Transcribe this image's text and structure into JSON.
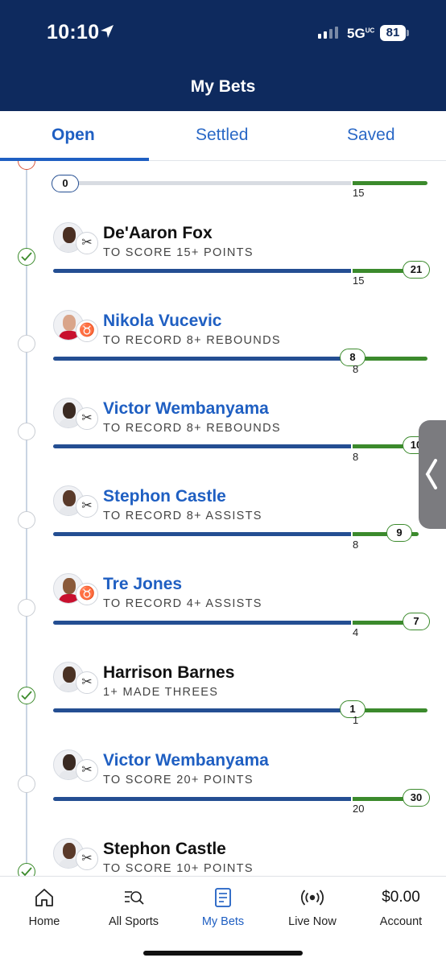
{
  "status_bar": {
    "time": "10:10",
    "network": "5G",
    "network_sup": "UC",
    "battery": "81"
  },
  "header": {
    "title": "My Bets"
  },
  "tabs": [
    {
      "label": "Open",
      "active": true
    },
    {
      "label": "Settled",
      "active": false
    },
    {
      "label": "Saved",
      "active": false
    }
  ],
  "partial_bet": {
    "current_value": "0",
    "target": "15"
  },
  "bets": [
    {
      "name": "De'Aaron Fox",
      "desc": "TO SCORE 15+ POINTS",
      "current": "21",
      "target": "15",
      "status": "won",
      "team": "spurs",
      "progress": 1.0
    },
    {
      "name": "Nikola Vucevic",
      "desc": "TO RECORD 8+ REBOUNDS",
      "current": "8",
      "target": "8",
      "status": "open",
      "team": "bulls",
      "progress": 1.0
    },
    {
      "name": "Victor Wembanyama",
      "desc": "TO RECORD 8+ REBOUNDS",
      "current": "10",
      "target": "8",
      "status": "open",
      "team": "spurs",
      "progress": 1.0
    },
    {
      "name": "Stephon Castle",
      "desc": "TO RECORD 8+ ASSISTS",
      "current": "9",
      "target": "8",
      "status": "open",
      "team": "spurs",
      "progress": 1.0
    },
    {
      "name": "Tre Jones",
      "desc": "TO RECORD 4+ ASSISTS",
      "current": "7",
      "target": "4",
      "status": "open",
      "team": "bulls",
      "progress": 1.0
    },
    {
      "name": "Harrison Barnes",
      "desc": "1+ MADE THREES",
      "current": "1",
      "target": "1",
      "status": "won",
      "team": "spurs",
      "progress": 1.0
    },
    {
      "name": "Victor Wembanyama",
      "desc": "TO SCORE 20+ POINTS",
      "current": "30",
      "target": "20",
      "status": "open",
      "team": "spurs",
      "progress": 1.0
    },
    {
      "name": "Stephon Castle",
      "desc": "TO SCORE 10+ POINTS",
      "current": "",
      "target": "",
      "status": "won",
      "team": "spurs",
      "progress": 1.0
    }
  ],
  "bottom_nav": [
    {
      "label": "Home",
      "icon": "home-icon"
    },
    {
      "label": "All Sports",
      "icon": "search-sports-icon"
    },
    {
      "label": "My Bets",
      "icon": "bet-slip-icon",
      "active": true
    },
    {
      "label": "Live Now",
      "icon": "live-broadcast-icon"
    },
    {
      "label": "Account",
      "icon": "balance",
      "balance": "$0.00"
    }
  ],
  "colors": {
    "navy": "#0e2a5e",
    "accent_blue": "#1f5fc2",
    "bar_blue": "#244e92",
    "win_green": "#3b8a2c"
  }
}
